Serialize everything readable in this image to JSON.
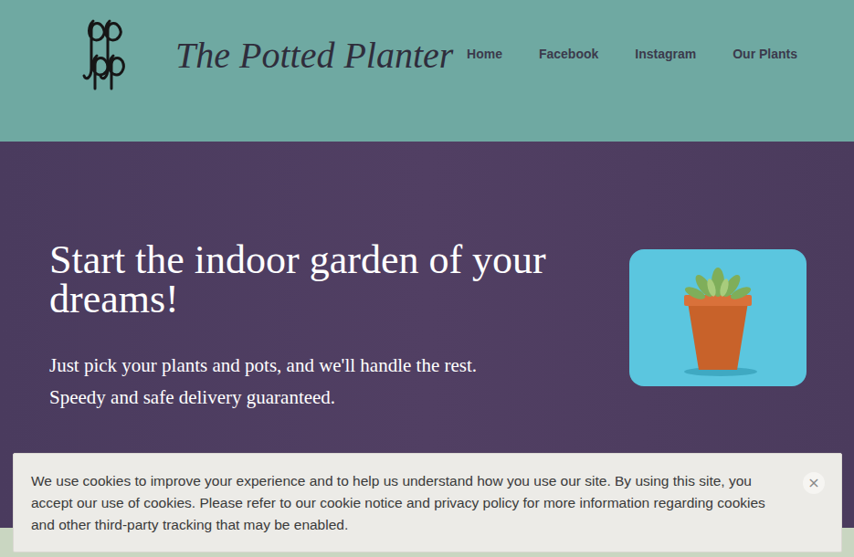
{
  "header": {
    "brand": "The Potted Planter",
    "nav": [
      {
        "label": "Home"
      },
      {
        "label": "Facebook"
      },
      {
        "label": "Instagram"
      },
      {
        "label": "Our Plants"
      }
    ]
  },
  "hero": {
    "title": "Start the indoor garden of your dreams!",
    "subtitle_lines": [
      "Just pick your plants and pots, and we'll handle the rest.",
      "Speedy and safe delivery guaranteed."
    ]
  },
  "cookie_banner": {
    "text": "We use cookies to improve your experience and to help us understand how you use our site. By using this site, you accept our use of cookies. Please refer to our cookie notice and privacy policy for more information regarding cookies and other third-party tracking that may be enabled.",
    "close": "×"
  }
}
